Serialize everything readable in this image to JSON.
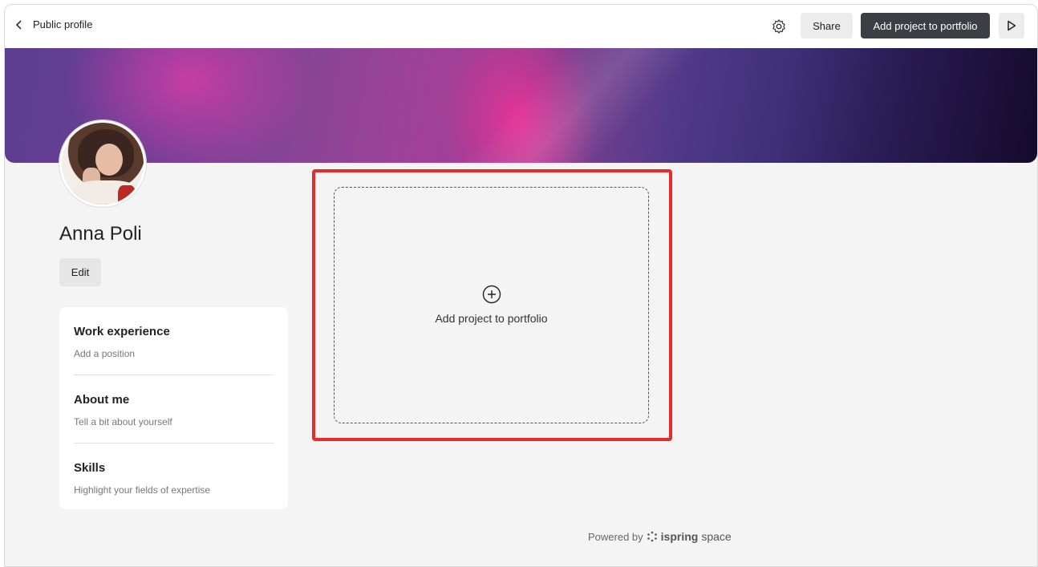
{
  "header": {
    "back_label": "Public profile",
    "share_label": "Share",
    "add_project_label": "Add project to portfolio",
    "icons": [
      "chevron-left-icon",
      "gear-icon",
      "play-icon"
    ]
  },
  "profile": {
    "name": "Anna Poli",
    "edit_label": "Edit"
  },
  "sections": [
    {
      "title": "Work experience",
      "subtitle": "Add a position"
    },
    {
      "title": "About me",
      "subtitle": "Tell a bit about yourself"
    },
    {
      "title": "Skills",
      "subtitle": "Highlight your fields of expertise"
    }
  ],
  "portfolio": {
    "add_label": "Add project to portfolio"
  },
  "footer": {
    "powered_by": "Powered by",
    "brand_bold": "ispring",
    "brand_light": "space"
  },
  "colors": {
    "primary_button": "#3b3f44",
    "highlight": "#e62b2b",
    "page_background": "#f4f4f4"
  }
}
